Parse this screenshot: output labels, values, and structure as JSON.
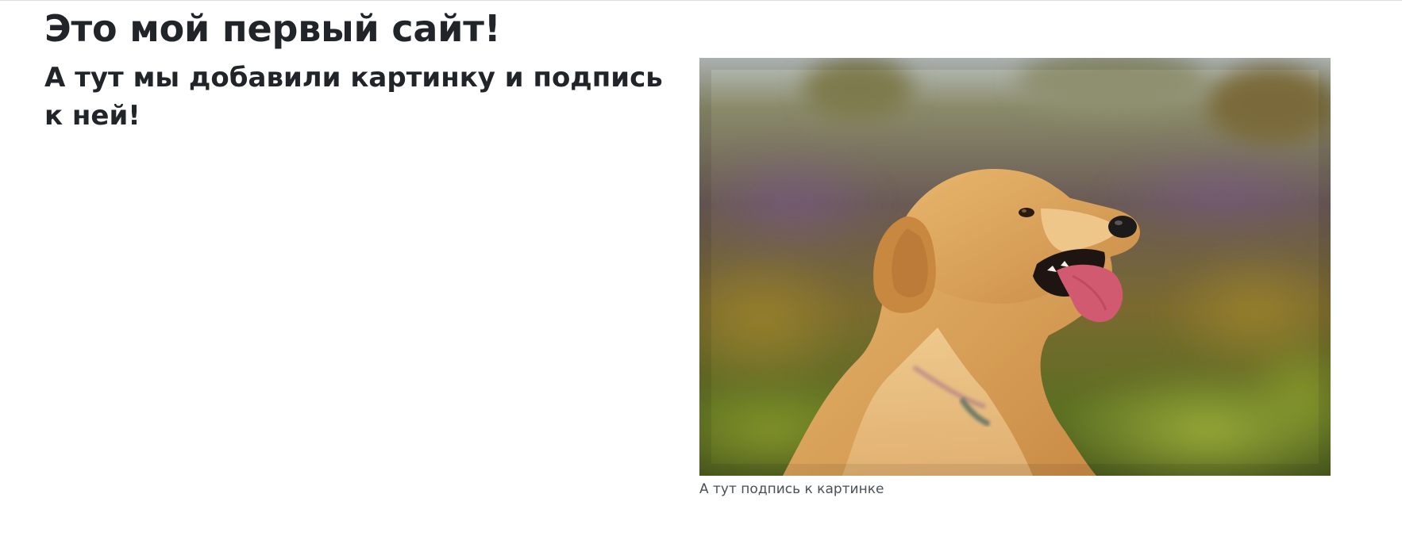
{
  "page": {
    "title": "Это мой первый сайт!",
    "subtitle": "А тут мы добавили картинку и подпись к ней!"
  },
  "figure": {
    "image_subject": "golden retriever dog",
    "caption": "А тут подпись к картинке"
  },
  "colors": {
    "text": "#212529",
    "caption": "#495057",
    "background": "#ffffff"
  }
}
